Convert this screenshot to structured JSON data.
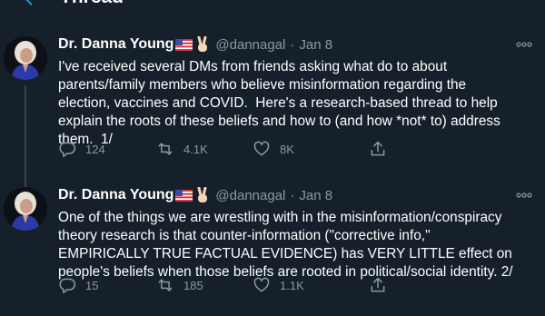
{
  "header": {
    "title": "Thread"
  },
  "tweets": [
    {
      "name": "Dr. Danna Young",
      "handle": "@dannagal",
      "separator": "·",
      "date": "Jan 8",
      "text": "I've received several DMs from friends asking what do to about\nparents/family members who believe misinformation regarding the\nelection, vaccines and COVID.  Here's a research-based thread to help\nexplain the roots of these beliefs and how to (and how *not* to) address\nthem.  1/",
      "replies": "124",
      "retweets": "4.1K",
      "likes": "8K"
    },
    {
      "name": "Dr. Danna Young",
      "handle": "@dannagal",
      "separator": "·",
      "date": "Jan 8",
      "text": "One of the things we are wrestling with in the misinformation/conspiracy\ntheory research is that counter-information (\"corrective info,\"\nEMPIRICALLY TRUE FACTUAL EVIDENCE) has VERY LITTLE effect on\npeople's beliefs when those beliefs are rooted in political/social identity. 2/",
      "replies": "15",
      "retweets": "185",
      "likes": "1.1K"
    }
  ],
  "colors": {
    "background": "#15202b",
    "secondary_text": "#8899a6",
    "thread_line": "#38444d"
  },
  "icons": [
    "back-arrow-icon",
    "avatar",
    "us-flag-icon",
    "victory-hand-icon",
    "more-icon",
    "reply-icon",
    "retweet-icon",
    "like-icon",
    "share-icon"
  ]
}
